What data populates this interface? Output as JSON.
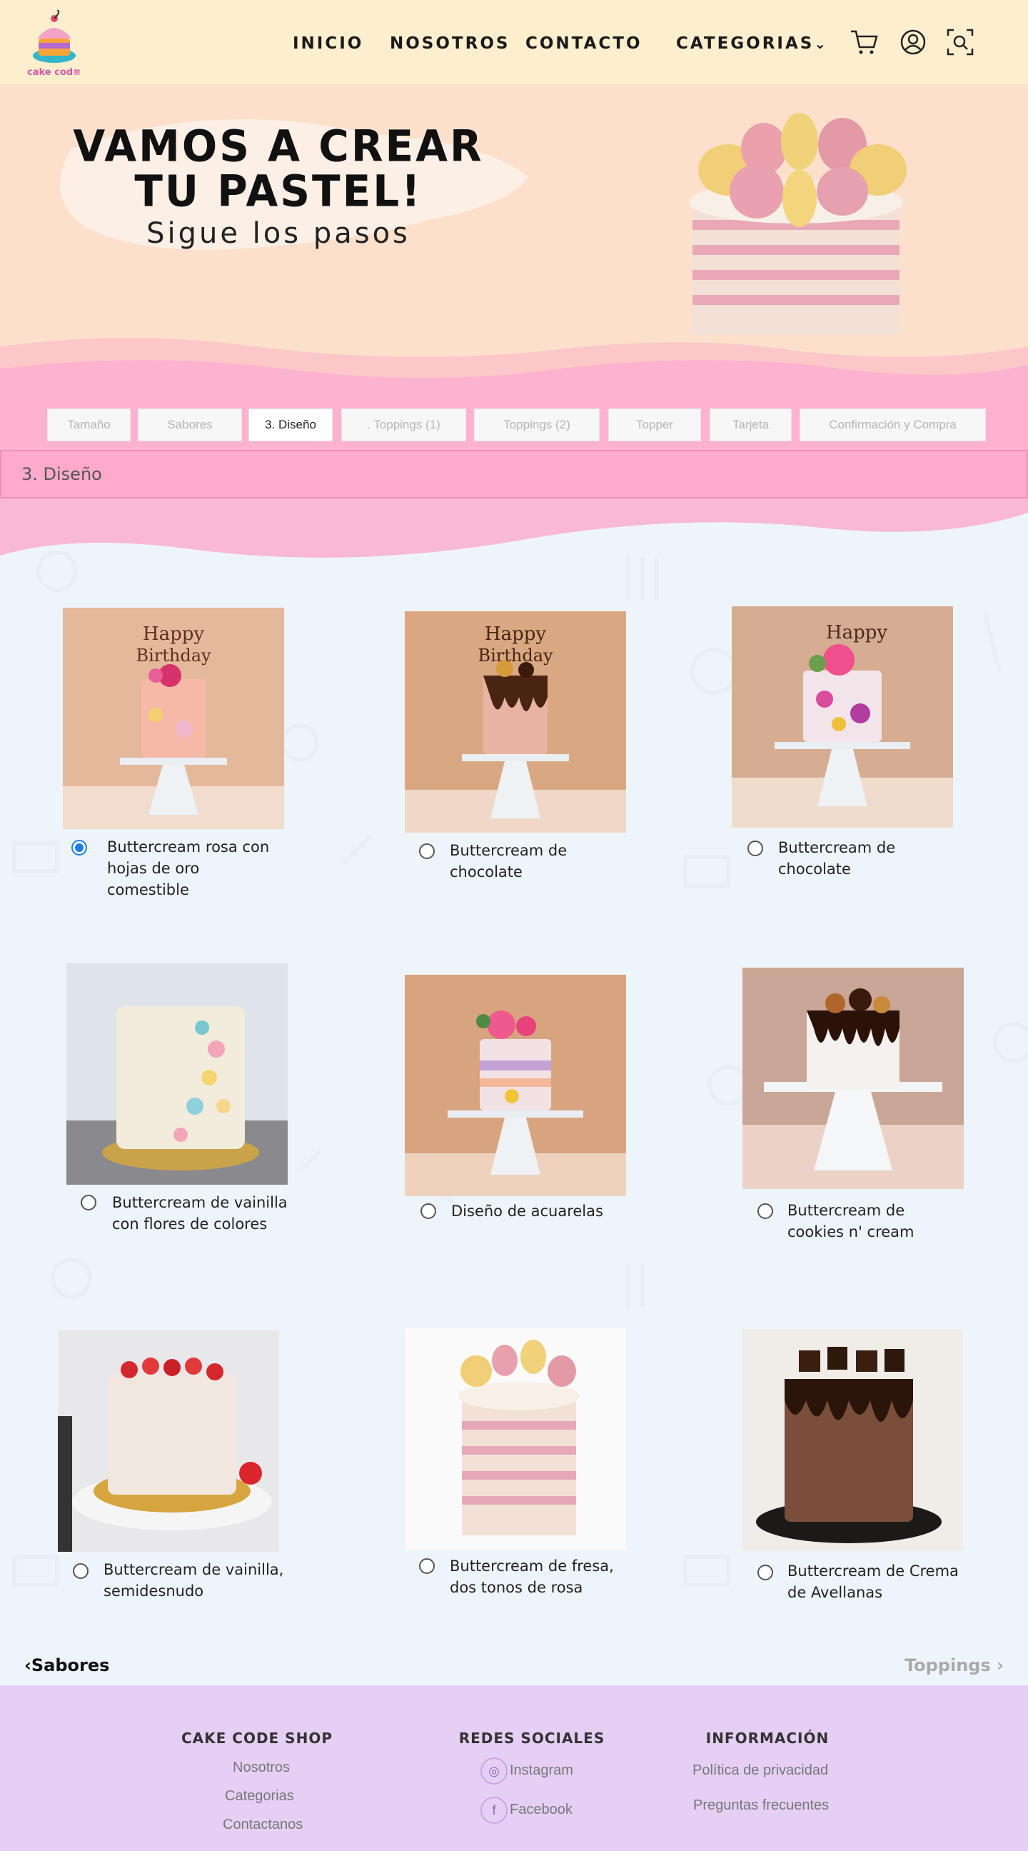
{
  "header": {
    "logo_text": "cake cod",
    "nav": [
      "INICIO",
      "NOSOTROS",
      "CONTACTO",
      "CATEGORIAS"
    ],
    "icons": [
      "cart-icon",
      "user-icon",
      "search-icon"
    ]
  },
  "hero": {
    "title_line1": "VAMOS A CREAR",
    "title_line2": "TU PASTEL!",
    "subtitle": "Sigue los pasos"
  },
  "steps": [
    {
      "label": "Tamaño",
      "active": false
    },
    {
      "label": "Sabores",
      "active": false
    },
    {
      "label": "3. Diseño",
      "active": true
    },
    {
      "label": ". Toppings (1)",
      "active": false
    },
    {
      "label": "Toppings (2)",
      "active": false
    },
    {
      "label": "Topper",
      "active": false
    },
    {
      "label": "Tarjeta",
      "active": false
    },
    {
      "label": "Confirmación y Compra",
      "active": false
    }
  ],
  "panel_title": "3. Diseño",
  "designs": [
    {
      "label": "Buttercream rosa con hojas de oro comestible",
      "selected": true
    },
    {
      "label": "Buttercream de chocolate",
      "selected": false
    },
    {
      "label": "Buttercream de chocolate",
      "selected": false
    },
    {
      "label": "Buttercream de vainilla con flores de colores",
      "selected": false
    },
    {
      "label": "Diseño de acuarelas",
      "selected": false
    },
    {
      "label": "Buttercream de cookies n' cream",
      "selected": false
    },
    {
      "label": "Buttercream de vainilla, semidesnudo",
      "selected": false
    },
    {
      "label": "Buttercream de fresa, dos tonos de rosa",
      "selected": false
    },
    {
      "label": "Buttercream de Crema de Avellanas",
      "selected": false
    }
  ],
  "nav_buttons": {
    "back": "Sabores",
    "forward": "Toppings"
  },
  "footer": {
    "col1": {
      "title": "CAKE CODE SHOP",
      "links": [
        "Nosotros",
        "Categorias",
        "Contactanos"
      ]
    },
    "col2": {
      "title": "REDES SOCIALES",
      "links": [
        "Instagram",
        "Facebook"
      ]
    },
    "col3": {
      "title": "INFORMACIÓN",
      "links": [
        "Política de privacidad",
        "Preguntas frecuentes"
      ]
    }
  },
  "colors": {
    "nav_bg": "#fdefce",
    "hero_bg": "#fde0cc",
    "pink": "#ffa9cc",
    "footer_bg": "#e6cff5",
    "radio_selected": "#1b7fe0"
  }
}
